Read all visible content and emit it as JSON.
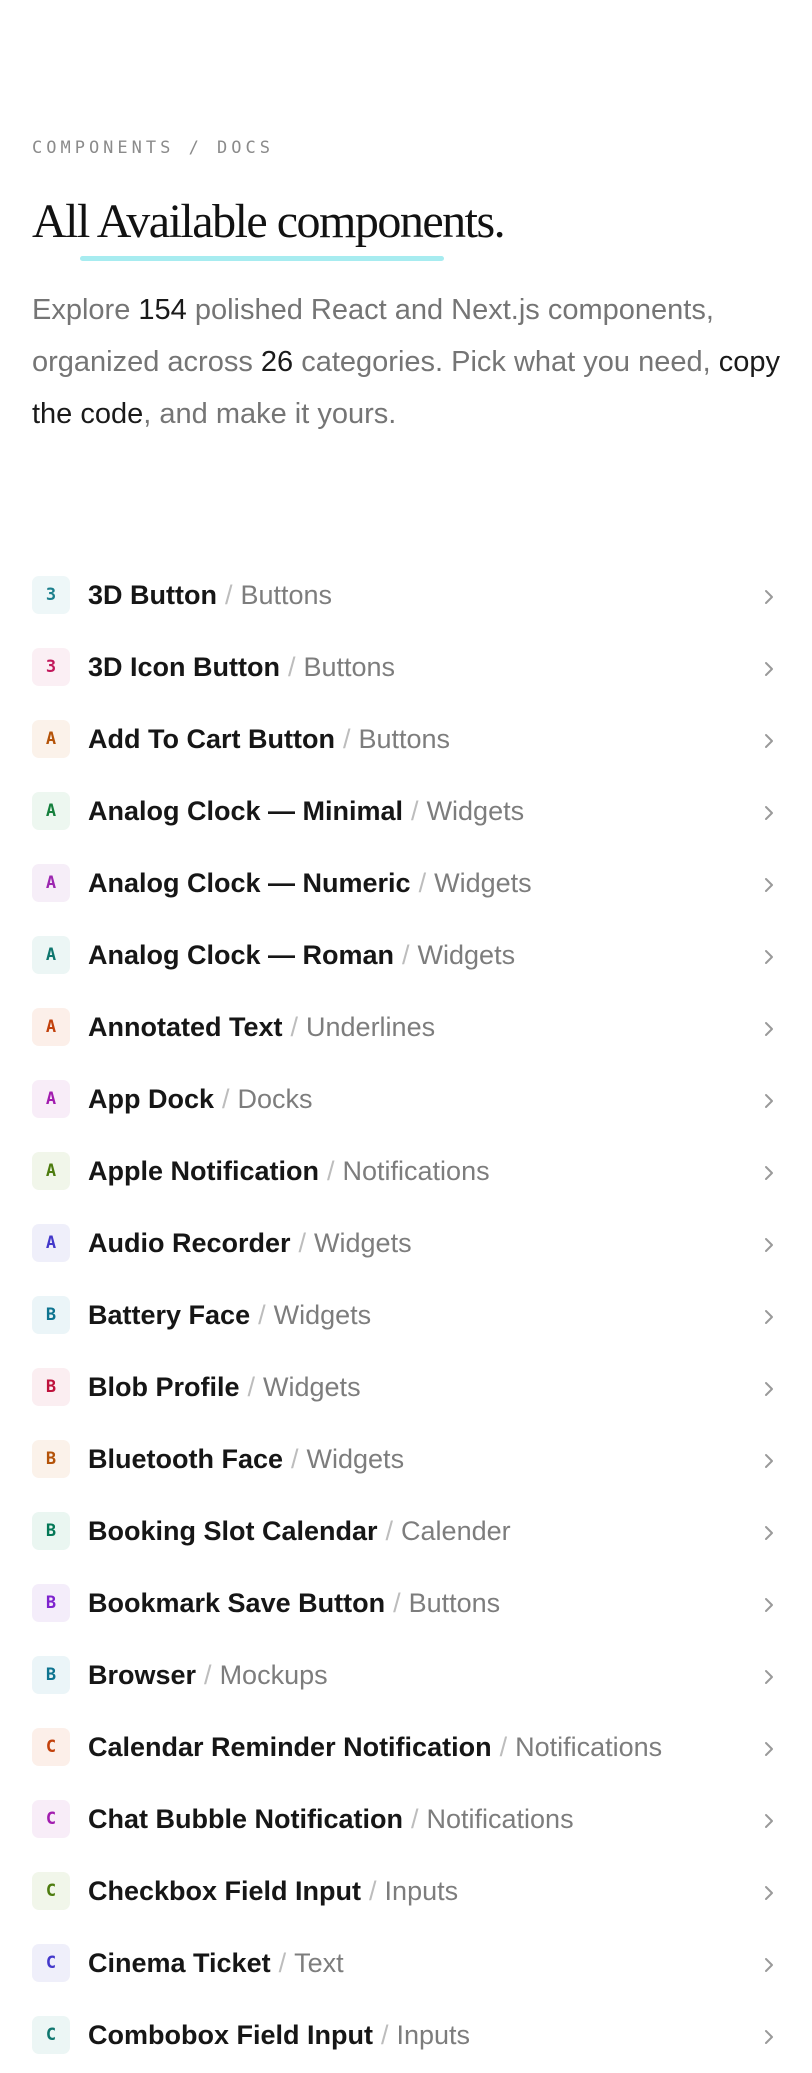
{
  "breadcrumb": "COMPONENTS / DOCS",
  "title": "All Available components.",
  "intro": {
    "part1": "Explore ",
    "count": "154",
    "part2": " polished React and Next.js components, organized across ",
    "categories": "26",
    "part3": " categories. Pick what you need, ",
    "link": "copy the code",
    "part4": ", and make it yours."
  },
  "separator": "/",
  "items": [
    {
      "initial": "3",
      "name": "3D Button",
      "category": "Buttons",
      "color": "#1c7f8c",
      "bg": "#eef7f8"
    },
    {
      "initial": "3",
      "name": "3D Icon Button",
      "category": "Buttons",
      "color": "#c2185b",
      "bg": "#fbeff4"
    },
    {
      "initial": "A",
      "name": "Add To Cart Button",
      "category": "Buttons",
      "color": "#b45309",
      "bg": "#fbf2ea"
    },
    {
      "initial": "A",
      "name": "Analog Clock — Minimal",
      "category": "Widgets",
      "color": "#15803d",
      "bg": "#edf7f0"
    },
    {
      "initial": "A",
      "name": "Analog Clock — Numeric",
      "category": "Widgets",
      "color": "#9c27b0",
      "bg": "#f6eef8"
    },
    {
      "initial": "A",
      "name": "Analog Clock — Roman",
      "category": "Widgets",
      "color": "#0f766e",
      "bg": "#ecf6f5"
    },
    {
      "initial": "A",
      "name": "Annotated Text",
      "category": "Underlines",
      "color": "#c2410c",
      "bg": "#fcefe9"
    },
    {
      "initial": "A",
      "name": "App Dock",
      "category": "Docks",
      "color": "#a21caf",
      "bg": "#f8edf8"
    },
    {
      "initial": "A",
      "name": "Apple Notification",
      "category": "Notifications",
      "color": "#4d7c0f",
      "bg": "#f1f6ea"
    },
    {
      "initial": "A",
      "name": "Audio Recorder",
      "category": "Widgets",
      "color": "#4338ca",
      "bg": "#efeffa"
    },
    {
      "initial": "B",
      "name": "Battery Face",
      "category": "Widgets",
      "color": "#0e7490",
      "bg": "#ebf5f8"
    },
    {
      "initial": "B",
      "name": "Blob Profile",
      "category": "Widgets",
      "color": "#be123c",
      "bg": "#fbeef1"
    },
    {
      "initial": "B",
      "name": "Bluetooth Face",
      "category": "Widgets",
      "color": "#b45309",
      "bg": "#fbf2ea"
    },
    {
      "initial": "B",
      "name": "Booking Slot Calendar",
      "category": "Calender",
      "color": "#047857",
      "bg": "#eaf6f1"
    },
    {
      "initial": "B",
      "name": "Bookmark Save Button",
      "category": "Buttons",
      "color": "#7e22ce",
      "bg": "#f4edfa"
    },
    {
      "initial": "B",
      "name": "Browser",
      "category": "Mockups",
      "color": "#0e7490",
      "bg": "#ebf5f8"
    },
    {
      "initial": "C",
      "name": "Calendar Reminder Notification",
      "category": "Notifications",
      "color": "#c2410c",
      "bg": "#fcefe9"
    },
    {
      "initial": "C",
      "name": "Chat Bubble Notification",
      "category": "Notifications",
      "color": "#a21caf",
      "bg": "#f8edf8"
    },
    {
      "initial": "C",
      "name": "Checkbox Field Input",
      "category": "Inputs",
      "color": "#4d7c0f",
      "bg": "#f1f6ea"
    },
    {
      "initial": "C",
      "name": "Cinema Ticket",
      "category": "Text",
      "color": "#4338ca",
      "bg": "#efeffa"
    },
    {
      "initial": "C",
      "name": "Combobox Field Input",
      "category": "Inputs",
      "color": "#0f766e",
      "bg": "#ecf6f5"
    }
  ]
}
